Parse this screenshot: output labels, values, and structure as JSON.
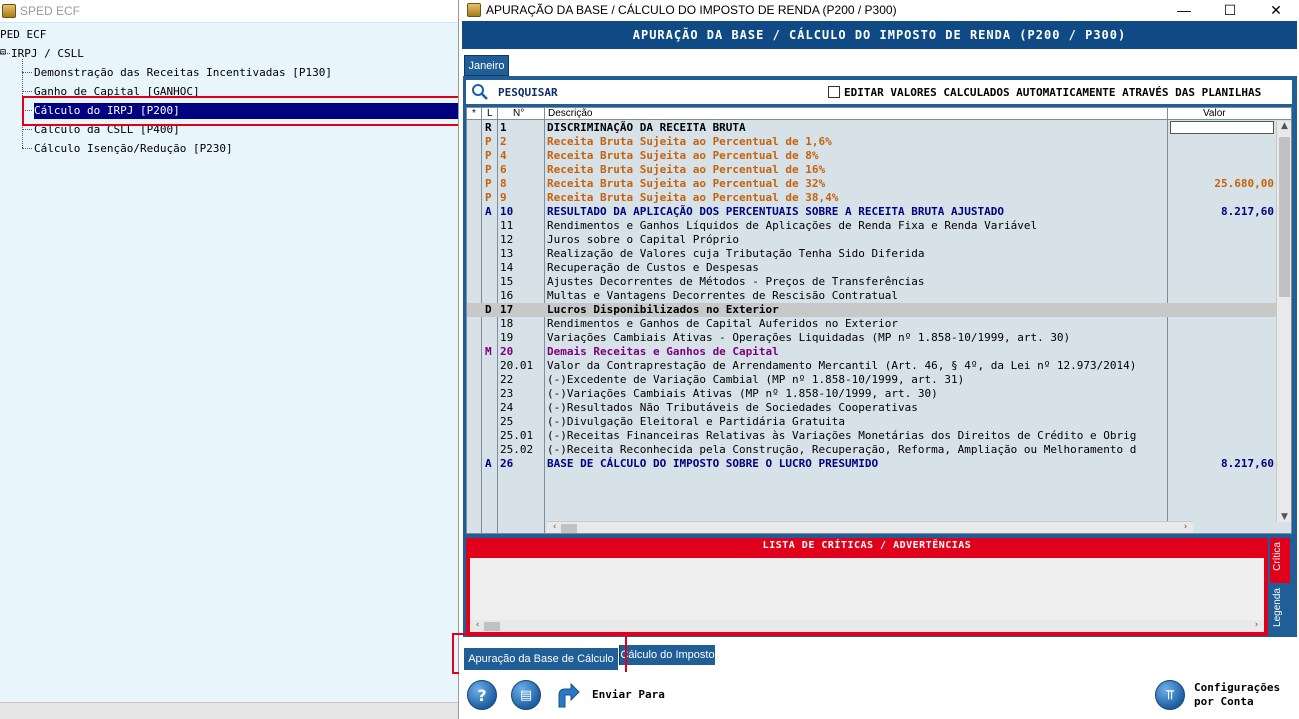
{
  "bg_window": {
    "title": "SPED ECF",
    "tree": {
      "root": "PED ECF",
      "group": "IRPJ / CSLL",
      "items": [
        {
          "label": "Demonstração das Receitas Incentivadas [P130]"
        },
        {
          "label": "Ganho de Capital [GANHOC]"
        },
        {
          "label": "Cálculo do IRPJ [P200]",
          "selected": true
        },
        {
          "label": "Cálculo da CSLL [P400]"
        },
        {
          "label": "Cálculo Isenção/Redução [P230]"
        }
      ]
    }
  },
  "dialog": {
    "title": "APURAÇÃO DA BASE / CÁLCULO DO IMPOSTO DE RENDA (P200 / P300)",
    "header": "APURAÇÃO DA BASE / CÁLCULO DO IMPOSTO DE RENDA (P200 / P300)",
    "month_tab": "Janeiro",
    "search_label": "PESQUISAR",
    "edit_checkbox_label": "EDITAR VALORES CALCULADOS AUTOMATICAMENTE ATRAVÉS DAS PLANILHAS",
    "edit_checked": false,
    "grid": {
      "columns": [
        "*",
        "L",
        "N°",
        "Descrição",
        "Valor"
      ],
      "rows": [
        {
          "l": "R",
          "n": "1",
          "desc": "DISCRIMINAÇÃO DA RECEITA BRUTA",
          "val": "",
          "style": "bold"
        },
        {
          "l": "P",
          "n": "2",
          "desc": "Receita Bruta Sujeita ao Percentual de 1,6%",
          "val": "",
          "style": "orange"
        },
        {
          "l": "P",
          "n": "4",
          "desc": "Receita Bruta Sujeita ao Percentual de 8%",
          "val": "",
          "style": "orange"
        },
        {
          "l": "P",
          "n": "6",
          "desc": "Receita Bruta Sujeita ao Percentual de 16%",
          "val": "",
          "style": "orange"
        },
        {
          "l": "P",
          "n": "8",
          "desc": "Receita Bruta Sujeita ao Percentual de 32%",
          "val": "25.680,00",
          "style": "orange"
        },
        {
          "l": "P",
          "n": "9",
          "desc": "Receita Bruta Sujeita ao Percentual de 38,4%",
          "val": "",
          "style": "orange"
        },
        {
          "l": "A",
          "n": "10",
          "desc": "RESULTADO DA APLICAÇÃO DOS PERCENTUAIS SOBRE A RECEITA BRUTA AJUSTADO",
          "val": "8.217,60",
          "style": "blue"
        },
        {
          "l": "",
          "n": "11",
          "desc": "Rendimentos e Ganhos Líquidos de Aplicações de Renda Fixa e Renda Variável",
          "val": "",
          "style": "normal"
        },
        {
          "l": "",
          "n": "12",
          "desc": "Juros sobre o Capital Próprio",
          "val": "",
          "style": "normal"
        },
        {
          "l": "",
          "n": "13",
          "desc": "Realização de Valores cuja Tributação Tenha Sido Diferida",
          "val": "",
          "style": "normal"
        },
        {
          "l": "",
          "n": "14",
          "desc": "Recuperação de Custos e Despesas",
          "val": "",
          "style": "normal"
        },
        {
          "l": "",
          "n": "15",
          "desc": "Ajustes Decorrentes de Métodos - Preços de Transferências",
          "val": "",
          "style": "normal"
        },
        {
          "l": "",
          "n": "16",
          "desc": "Multas e Vantagens Decorrentes de Rescisão Contratual",
          "val": "",
          "style": "normal"
        },
        {
          "l": "D",
          "n": "17",
          "desc": "Lucros Disponibilizados no Exterior",
          "val": "",
          "style": "bold-gray"
        },
        {
          "l": "",
          "n": "18",
          "desc": "Rendimentos e Ganhos de Capital Auferidos no Exterior",
          "val": "",
          "style": "normal"
        },
        {
          "l": "",
          "n": "19",
          "desc": "Variações Cambiais Ativas - Operações Liquidadas (MP nº 1.858-10/1999, art. 30)",
          "val": "",
          "style": "normal"
        },
        {
          "l": "M",
          "n": "20",
          "desc": "Demais Receitas e Ganhos de Capital",
          "val": "",
          "style": "purple"
        },
        {
          "l": "",
          "n": "20.01",
          "desc": "Valor da Contraprestação de Arrendamento Mercantil (Art. 46, § 4º, da Lei nº 12.973/2014)",
          "val": "",
          "style": "normal"
        },
        {
          "l": "",
          "n": "22",
          "desc": "(-)Excedente de Variação Cambial (MP nº 1.858-10/1999, art. 31)",
          "val": "",
          "style": "normal"
        },
        {
          "l": "",
          "n": "23",
          "desc": "(-)Variações Cambiais Ativas (MP nº 1.858-10/1999, art. 30)",
          "val": "",
          "style": "normal"
        },
        {
          "l": "",
          "n": "24",
          "desc": "(-)Resultados Não Tributáveis de Sociedades Cooperativas",
          "val": "",
          "style": "normal"
        },
        {
          "l": "",
          "n": "25",
          "desc": "(-)Divulgação Eleitoral e Partidária Gratuita",
          "val": "",
          "style": "normal"
        },
        {
          "l": "",
          "n": "25.01",
          "desc": "(-)Receitas Financeiras Relativas às Variações Monetárias dos Direitos de Crédito e Obrig",
          "val": "",
          "style": "normal"
        },
        {
          "l": "",
          "n": "25.02",
          "desc": "(-)Receita Reconhecida pela Construção, Recuperação, Reforma, Ampliação ou Melhoramento d",
          "val": "",
          "style": "normal"
        },
        {
          "l": "A",
          "n": "26",
          "desc": "BASE DE CÁLCULO DO IMPOSTO SOBRE O LUCRO PRESUMIDO",
          "val": "8.217,60",
          "style": "blue"
        }
      ]
    },
    "criticas_title": "LISTA DE CRÍTICAS / ADVERTÊNCIAS",
    "side_tabs": {
      "critica": "Crítica",
      "legenda": "Legenda"
    },
    "bottom_tabs": [
      "Apuração da Base de Cálculo",
      "Cálculo do Imposto"
    ],
    "bottom": {
      "send_label": "Enviar Para",
      "config_line1": "Configurações",
      "config_line2": "por Conta"
    },
    "colors": {
      "header_blue": "#0f4a84",
      "panel_blue": "#1f5e97",
      "orange": "#c8620a",
      "navy": "#000080",
      "purple": "#800080",
      "red": "#e0001b"
    }
  }
}
